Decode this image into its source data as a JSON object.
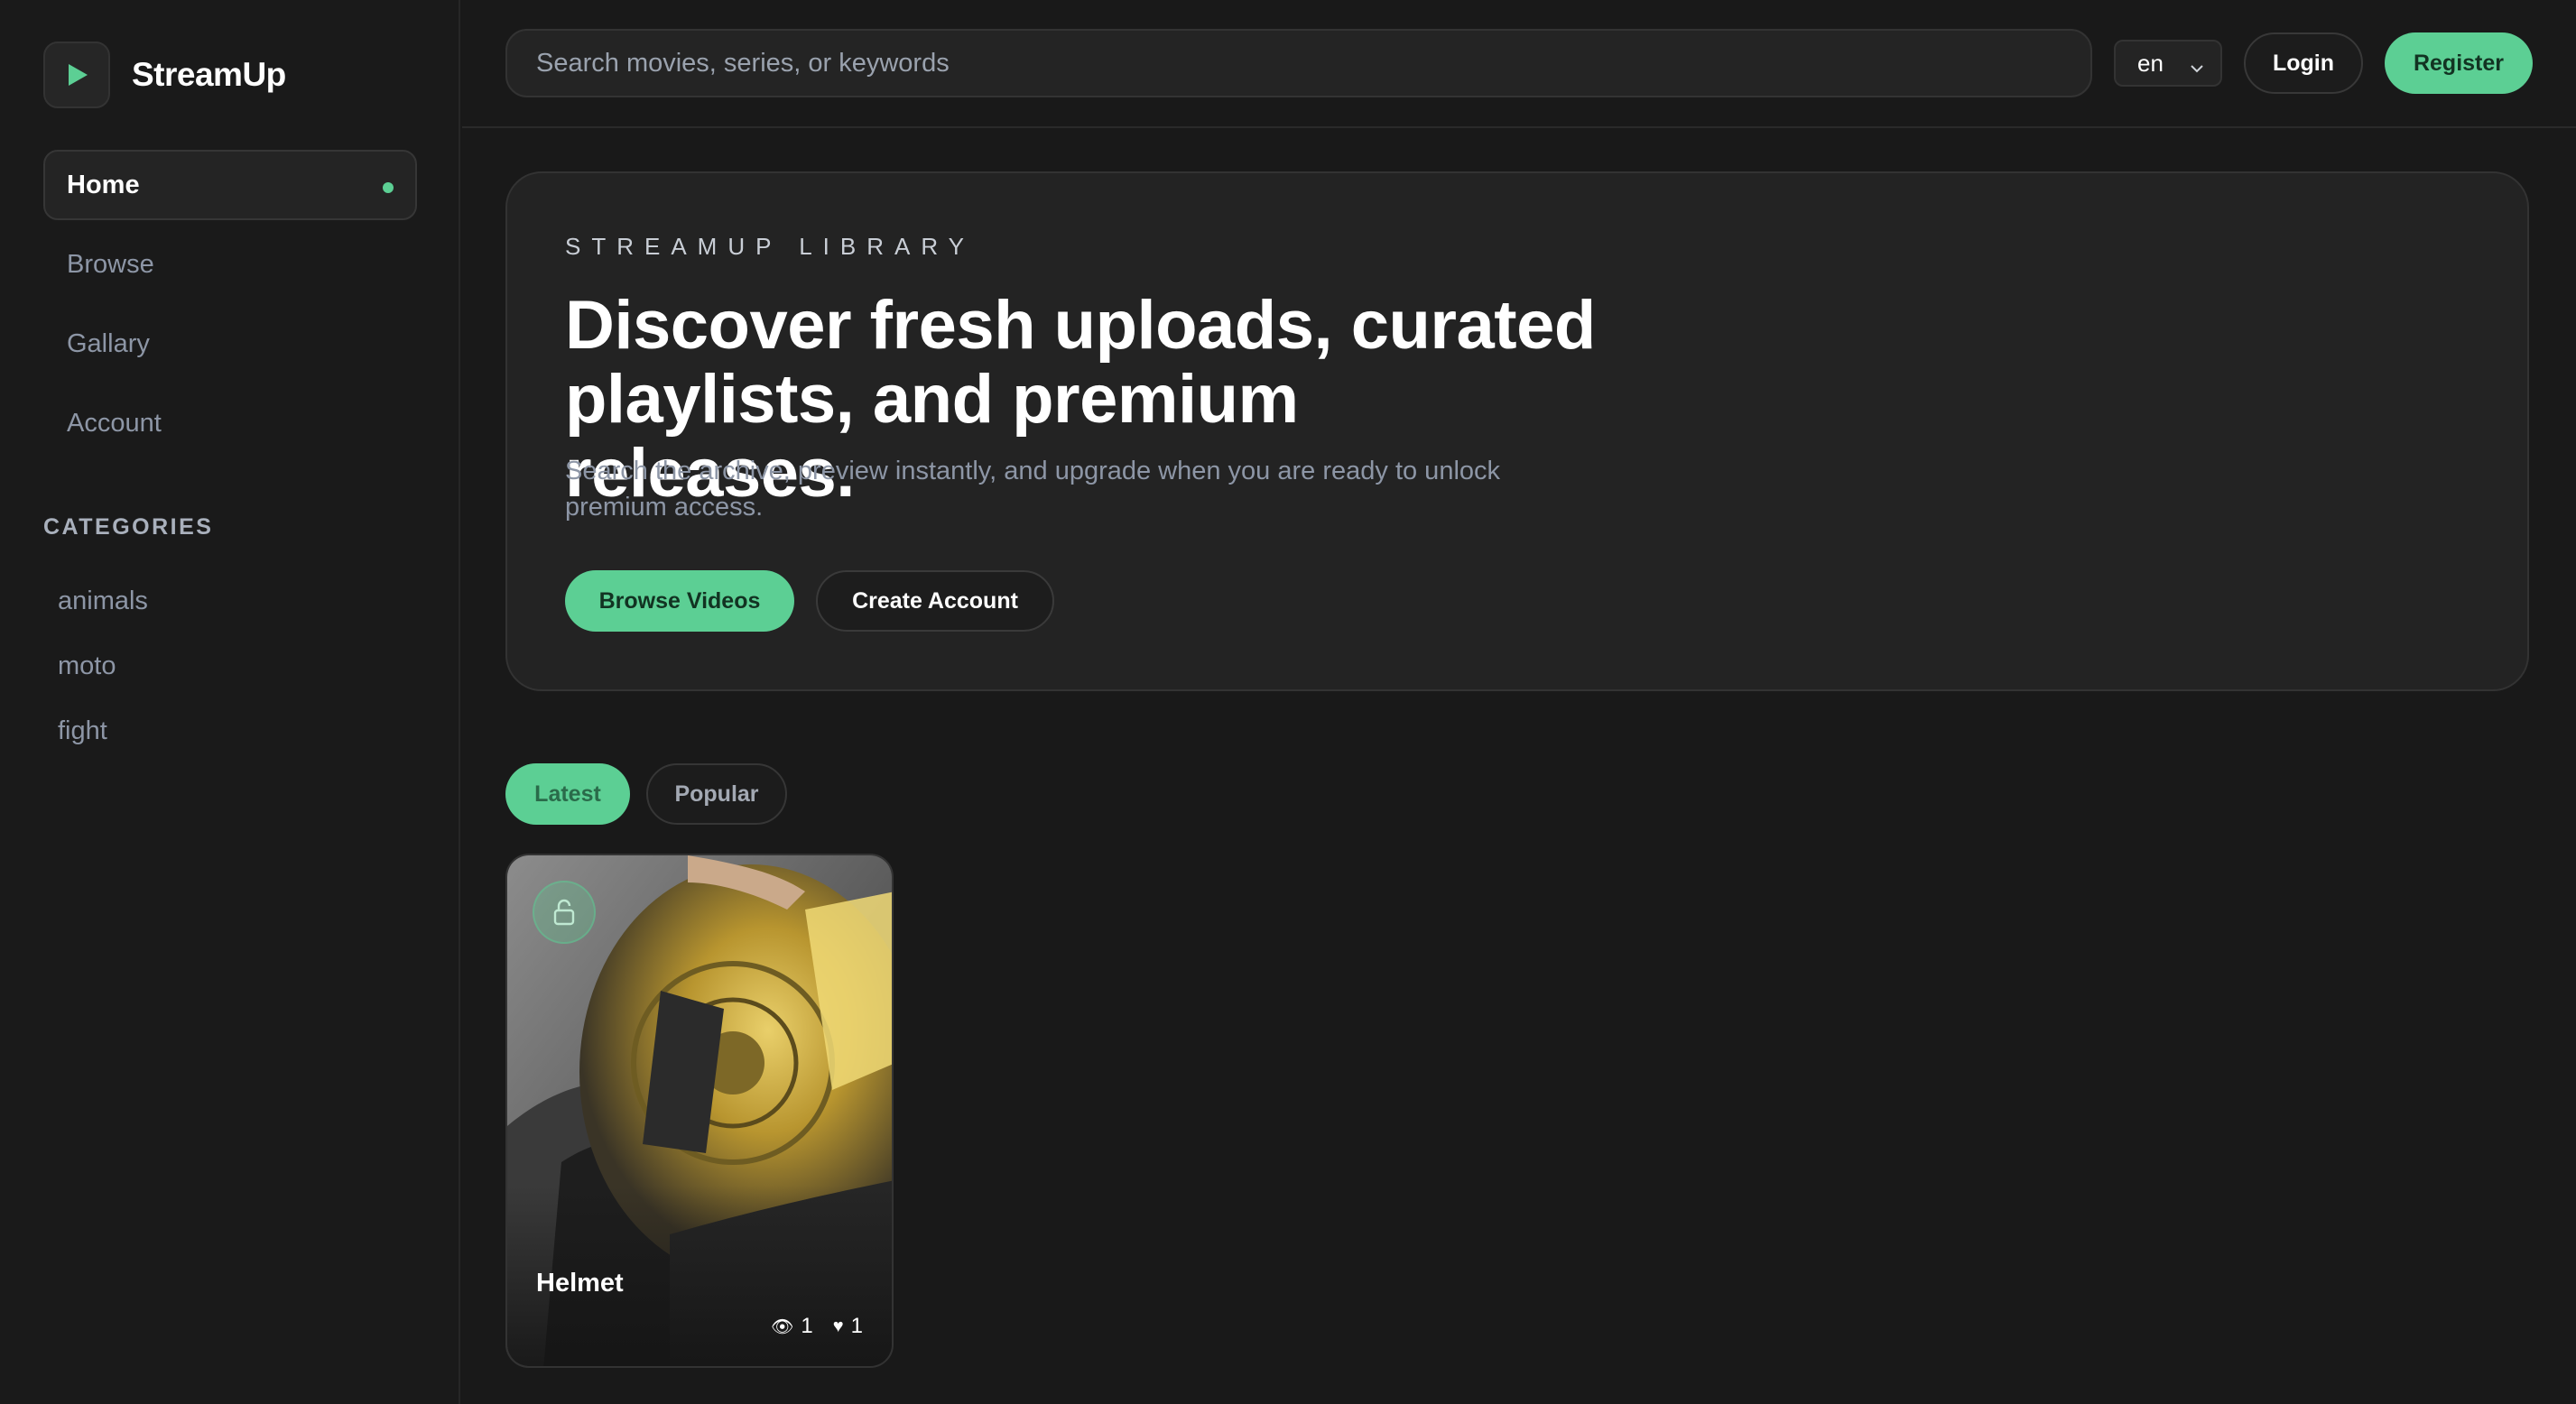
{
  "app": {
    "name": "StreamUp",
    "accent_color": "#5ccf94",
    "logo_icon": "play-icon"
  },
  "sidebar": {
    "nav": [
      {
        "label": "Home",
        "active": true
      },
      {
        "label": "Browse",
        "active": false
      },
      {
        "label": "Gallary",
        "active": false
      },
      {
        "label": "Account",
        "active": false
      }
    ],
    "categories_title": "CATEGORIES",
    "categories": [
      "animals",
      "moto",
      "fight"
    ]
  },
  "header": {
    "search_placeholder": "Search movies, series, or keywords",
    "search_value": "",
    "language": "en",
    "login_label": "Login",
    "register_label": "Register"
  },
  "hero": {
    "eyebrow": "STREAMUP LIBRARY",
    "headline": "Discover fresh uploads, curated playlists, and premium releases.",
    "subtext": "Search the archive, preview instantly, and upgrade when you are ready to unlock premium access.",
    "primary_cta": "Browse Videos",
    "secondary_cta": "Create Account"
  },
  "tabs": [
    {
      "label": "Latest",
      "active": true
    },
    {
      "label": "Popular",
      "active": false
    }
  ],
  "videos": [
    {
      "title": "Helmet",
      "views": "1",
      "likes": "1",
      "lock_icon": "unlock-icon",
      "view_icon": "eye-icon",
      "like_icon": "heart-icon"
    }
  ]
}
